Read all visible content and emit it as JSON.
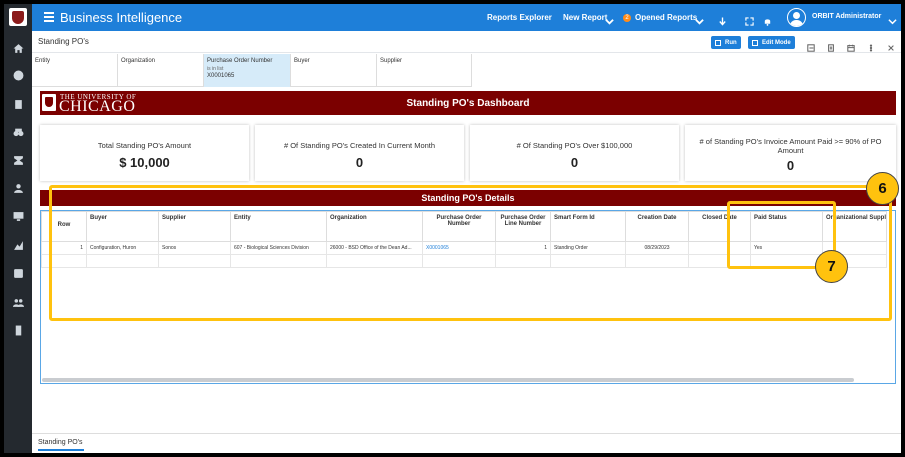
{
  "app": {
    "title": "Business Intelligence",
    "nav": {
      "reports_explorer": "Reports Explorer",
      "new_report": "New Report",
      "opened_reports": "Opened Reports",
      "opened_count": "2",
      "user": "ORBIT Administrator"
    }
  },
  "page": {
    "title": "Standing PO's",
    "run_label": "Run",
    "edit_mode_label": "Edit Mode",
    "bottom_tab": "Standing PO's"
  },
  "filters": [
    {
      "label": "Entity",
      "sub": "",
      "value": ""
    },
    {
      "label": "Organization",
      "sub": "",
      "value": ""
    },
    {
      "label": "Purchase Order Number",
      "sub": "is in list",
      "value": "X0001065"
    },
    {
      "label": "Buyer",
      "sub": "",
      "value": ""
    },
    {
      "label": "Supplier",
      "sub": "",
      "value": ""
    }
  ],
  "banner": {
    "uni_line1": "THE UNIVERSITY OF",
    "uni_line2": "CHICAGO",
    "title": "Standing PO's Dashboard"
  },
  "kpis": [
    {
      "label": "Total Standing PO's Amount",
      "value": "$ 10,000"
    },
    {
      "label": "# Of Standing PO's Created In Current Month",
      "value": "0"
    },
    {
      "label": "# Of Standing PO's Over $100,000",
      "value": "0"
    },
    {
      "label": "# of Standing PO's Invoice Amount Paid >= 90% of PO Amount",
      "value": "0"
    }
  ],
  "details": {
    "title": "Standing PO's Details",
    "columns": [
      "Row",
      "Buyer",
      "Supplier",
      "Entity",
      "Organization",
      "Purchase Order Number",
      "Purchase Order Line Number",
      "Smart Form Id",
      "Creation Date",
      "Closed Date",
      "Paid Status",
      "Organizational Supplie"
    ],
    "rows": [
      [
        "1",
        "Configuration, Huron",
        "Sonos",
        "607 - Biological Sciences Division",
        "26000 - BSD Office of the Dean Ad...",
        "X0001065",
        "1",
        "Standing Order",
        "08/29/2023",
        "",
        "Yes",
        ""
      ]
    ]
  },
  "annotations": {
    "six": "6",
    "seven": "7"
  },
  "colors": {
    "brand_blue": "#1e7fd9",
    "maroon": "#7b0000",
    "highlight": "#ffc20e",
    "sidebar": "#24292f"
  }
}
